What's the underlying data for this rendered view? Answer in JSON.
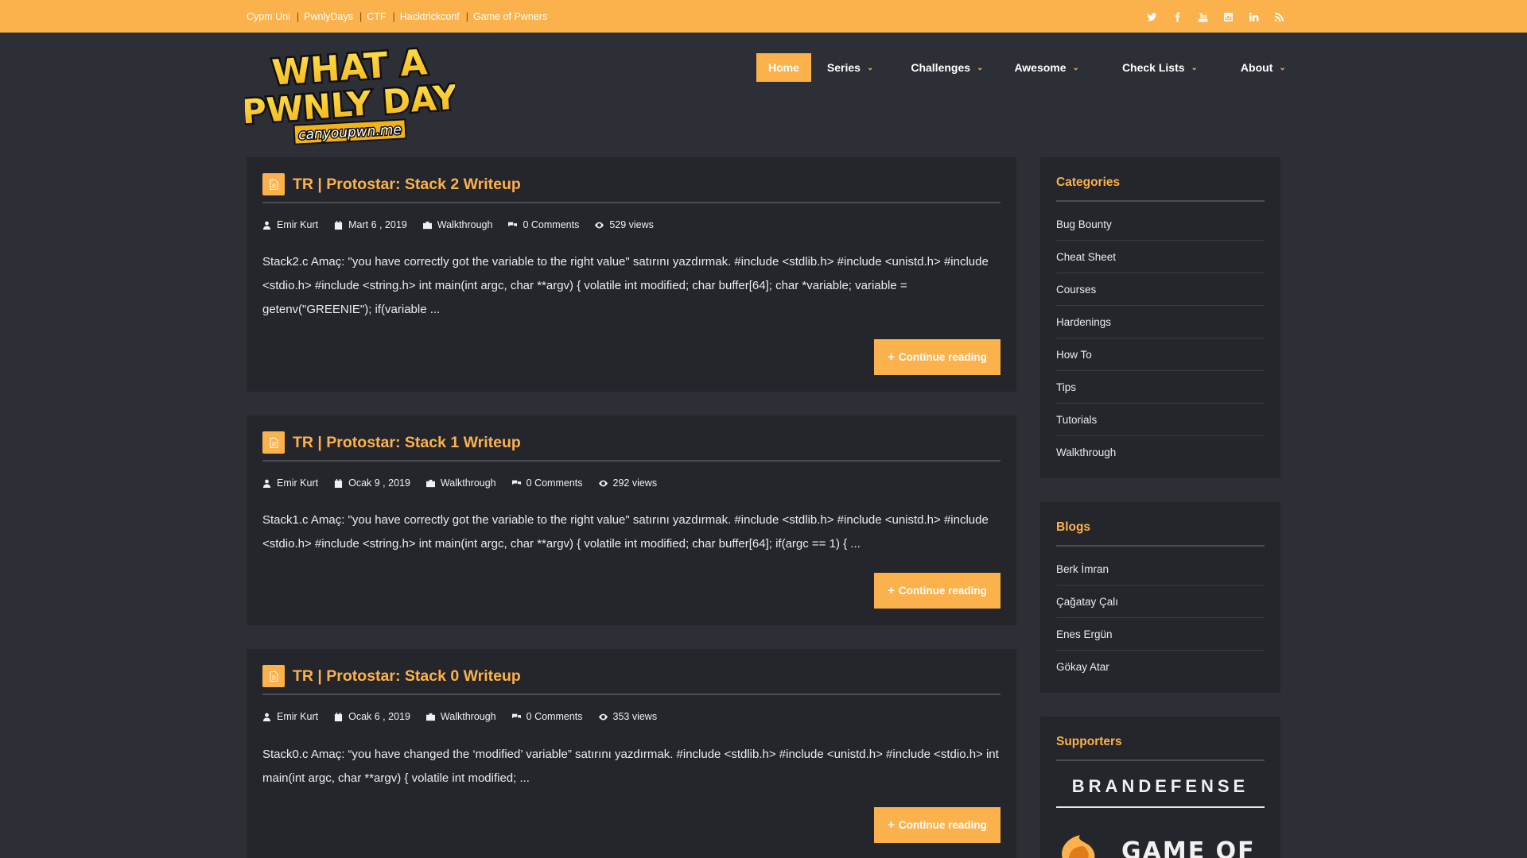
{
  "topbar": {
    "links": [
      "Cypm Uni",
      "PwnlyDays",
      "CTF",
      "Hacktrickconf",
      "Game of Pwners"
    ],
    "social_icons": [
      "twitter-icon",
      "facebook-icon",
      "youtube-icon",
      "instagram-icon",
      "linkedin-icon",
      "rss-icon"
    ]
  },
  "logo": {
    "line1": "WHAT A",
    "line2": "PWNLY DAY",
    "domain": "canyoupwn.me"
  },
  "nav": {
    "items": [
      "Home",
      "Series",
      "Challenges",
      "Awesome",
      "Check Lists",
      "About"
    ]
  },
  "posts": [
    {
      "title": "TR | Protostar: Stack 2 Writeup",
      "author": "Emir Kurt",
      "date": "Mart 6 , 2019",
      "category": "Walkthrough",
      "comments": "0 Comments",
      "views": "529 views",
      "excerpt": "Stack2.c Amaç: \"you have correctly got the variable to the right value\" satırını yazdırmak. #include <stdlib.h> #include <unistd.h> #include <stdio.h> #include <string.h> int main(int argc, char **argv) { volatile int modified; char buffer[64]; char *variable; variable = getenv(\"GREENIE\"); if(variable ...",
      "button": "Continue reading"
    },
    {
      "title": "TR | Protostar: Stack 1 Writeup",
      "author": "Emir Kurt",
      "date": "Ocak 9 , 2019",
      "category": "Walkthrough",
      "comments": "0 Comments",
      "views": "292 views",
      "excerpt": "Stack1.c Amaç: \"you have correctly got the variable to the right value\" satırını yazdırmak. #include <stdlib.h> #include <unistd.h> #include <stdio.h> #include <string.h> int main(int argc, char **argv) { volatile int modified; char buffer[64]; if(argc == 1) { ...",
      "button": "Continue reading"
    },
    {
      "title": "TR | Protostar: Stack 0 Writeup",
      "author": "Emir Kurt",
      "date": "Ocak 6 , 2019",
      "category": "Walkthrough",
      "comments": "0 Comments",
      "views": "353 views",
      "excerpt": "Stack0.c Amaç: “you have changed the ‘modified’ variable” satırını yazdırmak. #include <stdlib.h> #include <unistd.h> #include <stdio.h> int main(int argc, char **argv) { volatile int modified; ...",
      "button": "Continue reading"
    }
  ],
  "sidebar": {
    "categories": {
      "title": "Categories",
      "items": [
        "Bug Bounty",
        "Cheat Sheet",
        "Courses",
        "Hardenings",
        "How To",
        "Tips",
        "Tutorials",
        "Walkthrough"
      ]
    },
    "blogs": {
      "title": "Blogs",
      "items": [
        "Berk İmran",
        "Çağatay Çalı",
        "Enes Ergün",
        "Gökay Atar"
      ]
    },
    "supporters": {
      "title": "Supporters",
      "logos": [
        "BRANDEFENSE",
        "GAME OF"
      ]
    }
  },
  "colors": {
    "accent": "#fcb24c",
    "background": "#2d2f36",
    "panel": "#24262b"
  }
}
